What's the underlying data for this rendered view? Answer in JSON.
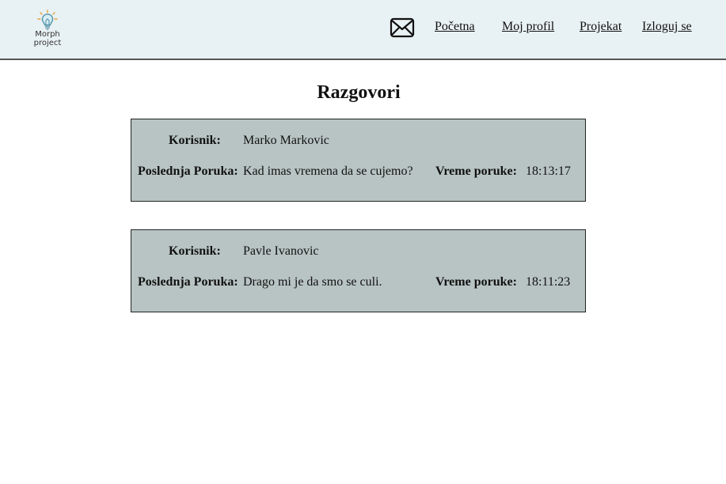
{
  "header": {
    "logo_text_line1": "Morph",
    "logo_text_line2": "project",
    "nav": {
      "home": "Početna",
      "profile": "Moj profil",
      "project": "Projekat",
      "logout": "Izloguj se"
    },
    "mail_icon": "envelope-icon"
  },
  "main": {
    "title": "Razgovori",
    "labels": {
      "user": "Korisnik:",
      "last_message": "Poslednja Poruka:",
      "message_time": "Vreme poruke:"
    },
    "conversations": [
      {
        "user": "Marko Markovic",
        "last_message": "Kad imas vremena da se cujemo?",
        "time": "18:13:17"
      },
      {
        "user": "Pavle Ivanovic",
        "last_message": "Drago mi je da smo se culi.",
        "time": "18:11:23"
      }
    ]
  }
}
